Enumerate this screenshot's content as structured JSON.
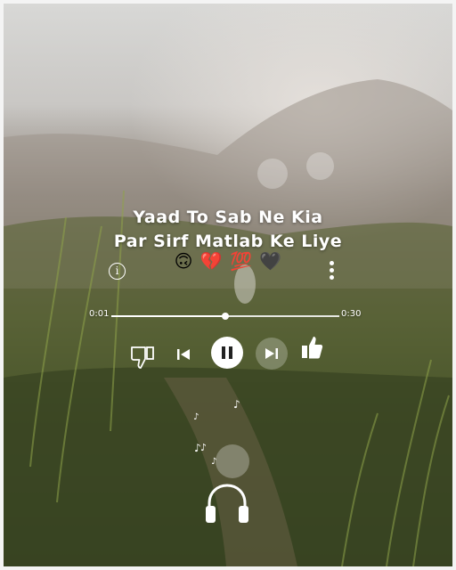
{
  "lyrics": {
    "line1": "Yaad To Sab Ne Kia",
    "line2": "Par Sirf Matlab Ke Liye",
    "emojis": [
      "🙃",
      "💔",
      "💯",
      "🖤"
    ]
  },
  "player": {
    "elapsed": "0:01",
    "total": "0:30",
    "progress_fraction": 0.5,
    "state": "playing"
  },
  "icons": {
    "info": "info-icon",
    "more": "more-vertical-icon",
    "dislike": "thumbs-down-icon",
    "previous": "skip-previous-icon",
    "pause": "pause-icon",
    "next": "skip-next-icon",
    "like": "thumbs-up-icon",
    "headphones": "headphones-icon",
    "music_note": "music-note-icon"
  },
  "colors": {
    "foreground": "#ffffff"
  },
  "info_symbol": "i"
}
